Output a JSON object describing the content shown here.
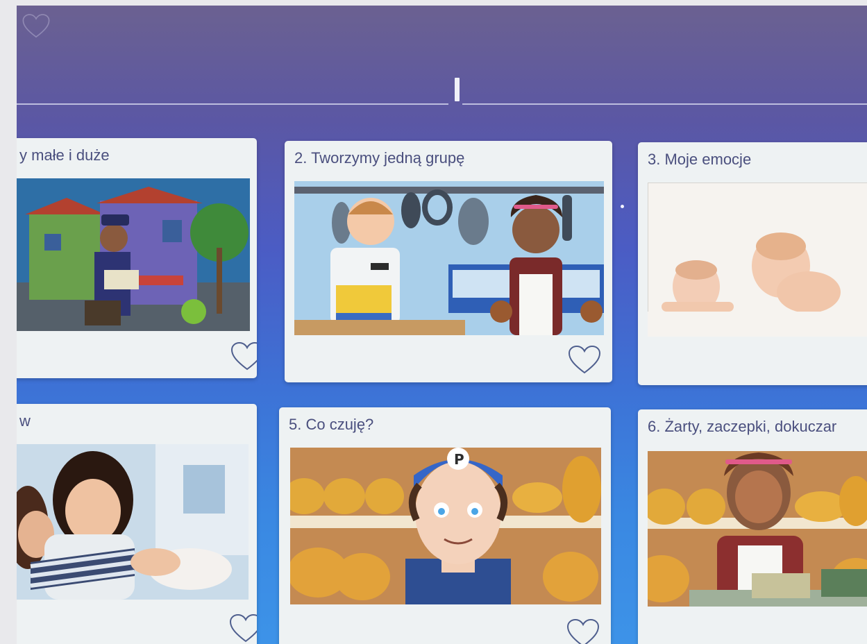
{
  "top_bar": {
    "favorites_icon": "heart-outline-icon"
  },
  "lessons": [
    {
      "title": "y małe i duże",
      "image": "street-mail-carrier-illustration",
      "favorite_icon": "heart-outline-icon"
    },
    {
      "title": "2. Tworzymy jedną grupę",
      "image": "butcher-shop-illustration",
      "favorite_icon": "heart-outline-icon"
    },
    {
      "title": "3. Moje emocje",
      "image": "two-babies-photo",
      "favorite_icon": "heart-outline-icon"
    },
    {
      "title": "w",
      "image": "two-girls-hugging-photo",
      "favorite_icon": "heart-outline-icon"
    },
    {
      "title": "5. Co czuję?",
      "image": "boy-in-bakery-illustration",
      "favorite_icon": "heart-outline-icon"
    },
    {
      "title": "6. Żarty, zaczepki, dokuczar",
      "image": "bakery-girl-illustration",
      "favorite_icon": "heart-outline-icon"
    }
  ],
  "colors": {
    "card_bg": "#eef2f3",
    "title_text": "#4a4f7e",
    "heart_stroke": "#4f5f8e"
  }
}
